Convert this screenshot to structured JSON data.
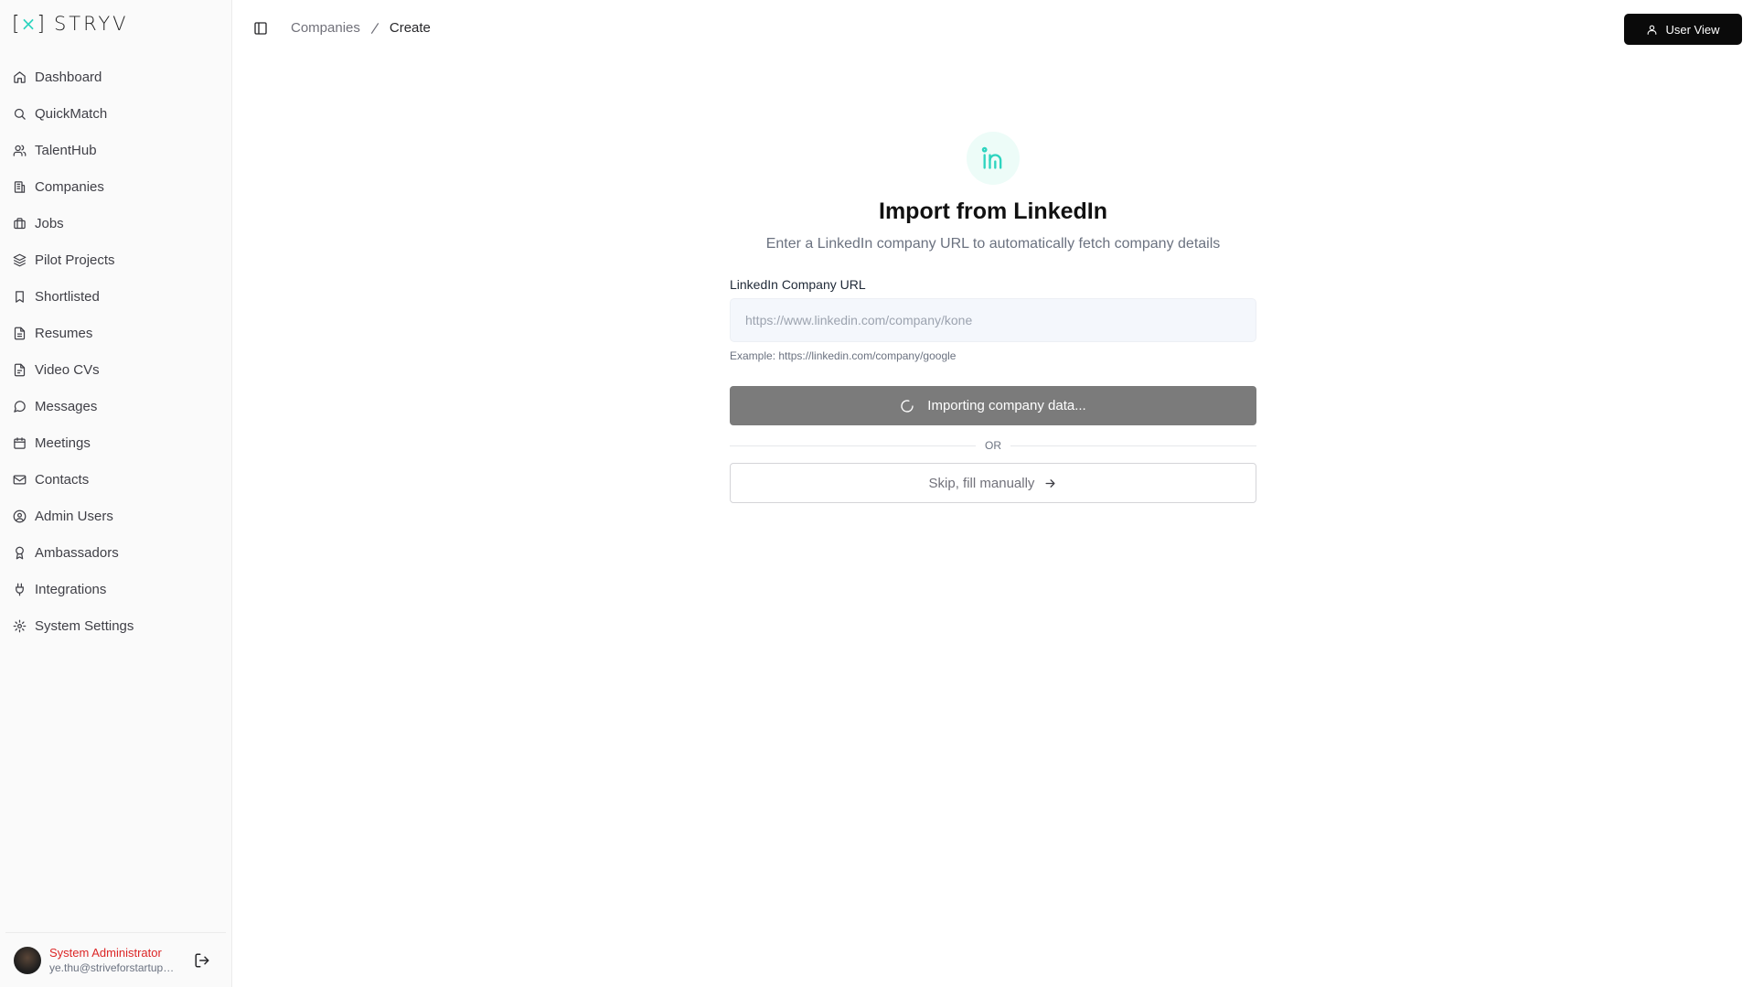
{
  "app": {
    "logo_text": "STRYV",
    "logo_left": "[",
    "logo_x": "×",
    "logo_right": "]"
  },
  "sidebar": {
    "items": [
      {
        "label": "Dashboard",
        "icon": "home-icon"
      },
      {
        "label": "QuickMatch",
        "icon": "search-icon"
      },
      {
        "label": "TalentHub",
        "icon": "users-icon"
      },
      {
        "label": "Companies",
        "icon": "building-icon"
      },
      {
        "label": "Jobs",
        "icon": "briefcase-icon"
      },
      {
        "label": "Pilot Projects",
        "icon": "layers-icon"
      },
      {
        "label": "Shortlisted",
        "icon": "bookmark-icon"
      },
      {
        "label": "Resumes",
        "icon": "file-icon"
      },
      {
        "label": "Video CVs",
        "icon": "file-video-icon"
      },
      {
        "label": "Messages",
        "icon": "message-icon"
      },
      {
        "label": "Meetings",
        "icon": "calendar-icon"
      },
      {
        "label": "Contacts",
        "icon": "mail-icon"
      },
      {
        "label": "Admin Users",
        "icon": "user-circle-icon"
      },
      {
        "label": "Ambassadors",
        "icon": "award-icon"
      },
      {
        "label": "Integrations",
        "icon": "plug-icon"
      },
      {
        "label": "System Settings",
        "icon": "settings-icon"
      }
    ],
    "user": {
      "name": "System Administrator",
      "email": "ye.thu@striveforstartups.com"
    }
  },
  "header": {
    "breadcrumb": {
      "parent": "Companies",
      "current": "Create"
    },
    "user_view_label": "User View"
  },
  "import": {
    "title": "Import from LinkedIn",
    "subtitle": "Enter a LinkedIn company URL to automatically fetch company details",
    "field_label": "LinkedIn Company URL",
    "url_placeholder": "https://www.linkedin.com/company/kone",
    "hint": "Example: https://linkedin.com/company/google",
    "import_button_label": "Importing company data...",
    "divider_text": "OR",
    "skip_button_label": "Skip, fill manually"
  },
  "colors": {
    "accent": "#2dd4bf",
    "danger": "#dc2626",
    "primary_btn": "#0a0a0a",
    "loading_btn": "#7b7b7b"
  }
}
